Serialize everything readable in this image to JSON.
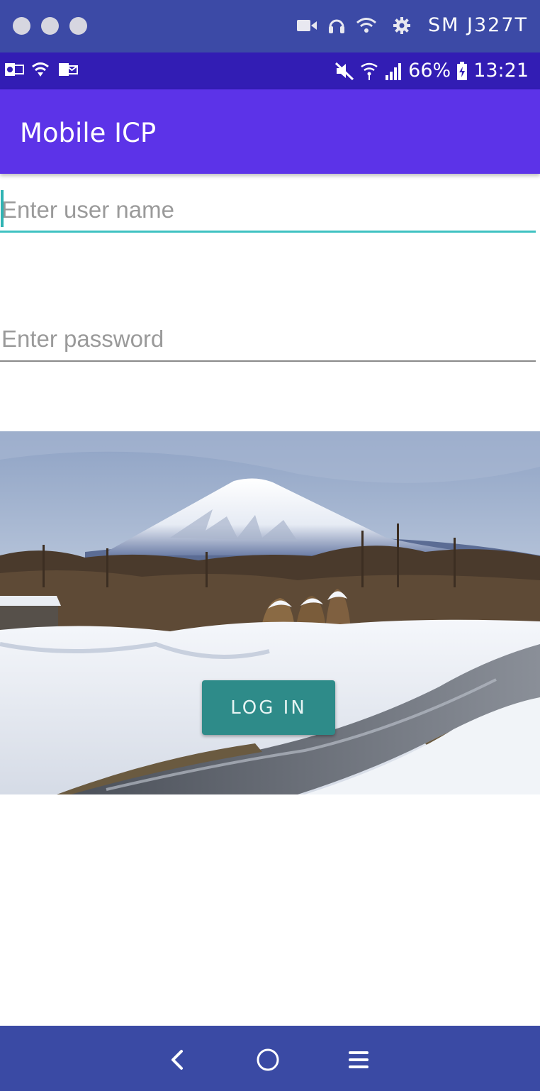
{
  "tool_bar": {
    "window_controls": [
      "close",
      "minimize",
      "maximize"
    ],
    "icons": [
      "video-camera-icon",
      "headphones-icon",
      "wifi-icon",
      "gear-icon"
    ],
    "device_name": "SM J327T"
  },
  "status_bar": {
    "left_icons": [
      "outlook-icon",
      "wifi-calling-icon",
      "mail-icon"
    ],
    "right_icons": [
      "mute-icon",
      "wifi-icon",
      "signal-icon",
      "battery-charging-icon"
    ],
    "battery": "66%",
    "time": "13:21"
  },
  "app_bar": {
    "title": "Mobile ICP"
  },
  "login_form": {
    "username_placeholder": "Enter user name",
    "username_value": "",
    "password_placeholder": "Enter password",
    "password_value": "",
    "login_label": "LOG IN"
  },
  "nav_bar": {
    "buttons": [
      "back",
      "home",
      "menu"
    ]
  },
  "colors": {
    "tool_bar": "#3c4aa6",
    "status_bar": "#321db4",
    "app_bar": "#5c33e8",
    "accent": "#3fc2c2",
    "button": "#2e8b89",
    "nav_bar": "#3a4aa4"
  }
}
